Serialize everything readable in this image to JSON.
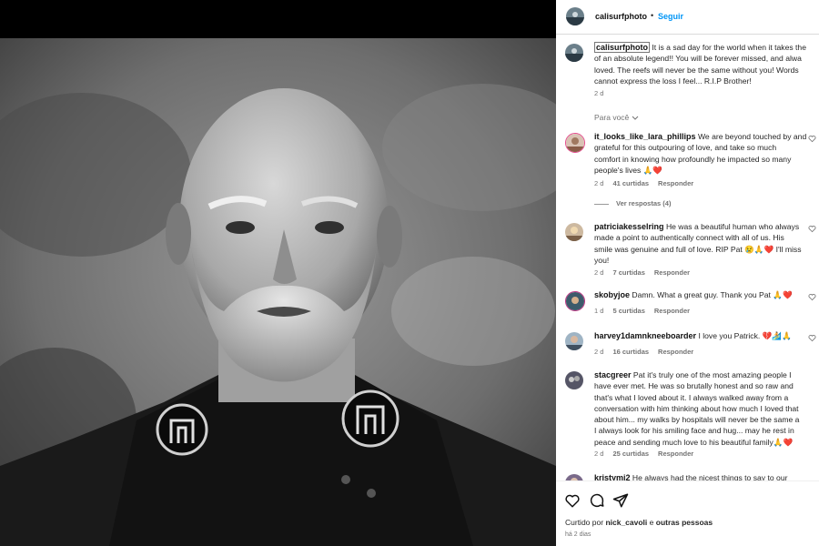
{
  "post": {
    "author": "calisurfphoto",
    "follow_label": "Seguir",
    "caption": {
      "lines": [
        "It is a sad day for the world when it takes the",
        "of an absolute legend!! You will be forever missed, and alwa",
        "loved. The reefs will never be the same without you! Words",
        "cannot express the loss I feel... R.I.P Brother!"
      ],
      "age": "2 d"
    },
    "for_you_label": "Para você"
  },
  "comments": [
    {
      "user": "it_looks_like_lara_phillips",
      "lines": [
        "We are beyond touched by and",
        "grateful for this outpouring of love, and take so much",
        "comfort in knowing how profoundly he impacted so many",
        "people's lives 🙏❤️"
      ],
      "age": "2 d",
      "likes": "41 curtidas",
      "reply": "Responder",
      "replies": "Ver respostas (4)"
    },
    {
      "user": "patriciakesselring",
      "lines": [
        "He was a beautiful human who always",
        "made a point to authentically connect with all of us. His",
        "smile was genuine and full of love. RIP Pat 😢🙏❤️ I'll miss",
        "you!"
      ],
      "age": "2 d",
      "likes": "7 curtidas",
      "reply": "Responder"
    },
    {
      "user": "skobyjoe",
      "lines": [
        "Damn. What a great guy. Thank you Pat 🙏❤️"
      ],
      "age": "1 d",
      "likes": "5 curtidas",
      "reply": "Responder"
    },
    {
      "user": "harvey1damnkneeboarder",
      "lines": [
        "I love you Patrick. 💔🏄🙏"
      ],
      "age": "2 d",
      "likes": "16 curtidas",
      "reply": "Responder"
    },
    {
      "user": "stacgreer",
      "lines": [
        "Pat it's truly one of the most amazing people I",
        "have ever met. He was so brutally honest and so raw and",
        "that's what I loved about it. I always walked away from a",
        "conversation with him thinking about how much I loved that",
        "about him... my walks by hospitals will never be the same a",
        "I always look for his smiling face and hug... may he rest in",
        "peace and sending much love to his beautiful family🙏❤️"
      ],
      "age": "2 d",
      "likes": "25 curtidas",
      "reply": "Responder"
    },
    {
      "user": "kristymj2",
      "lines": [
        "He always had the nicest things to say to our"
      ]
    }
  ],
  "footer": {
    "liked_prefix": "Curtido por",
    "liked_user": "nick_cavoli",
    "liked_mid": "e",
    "liked_others": "outras pessoas",
    "date": "há 2 dias"
  },
  "icons": [
    "heart-icon",
    "comment-icon",
    "share-icon",
    "chevron-down-icon"
  ]
}
